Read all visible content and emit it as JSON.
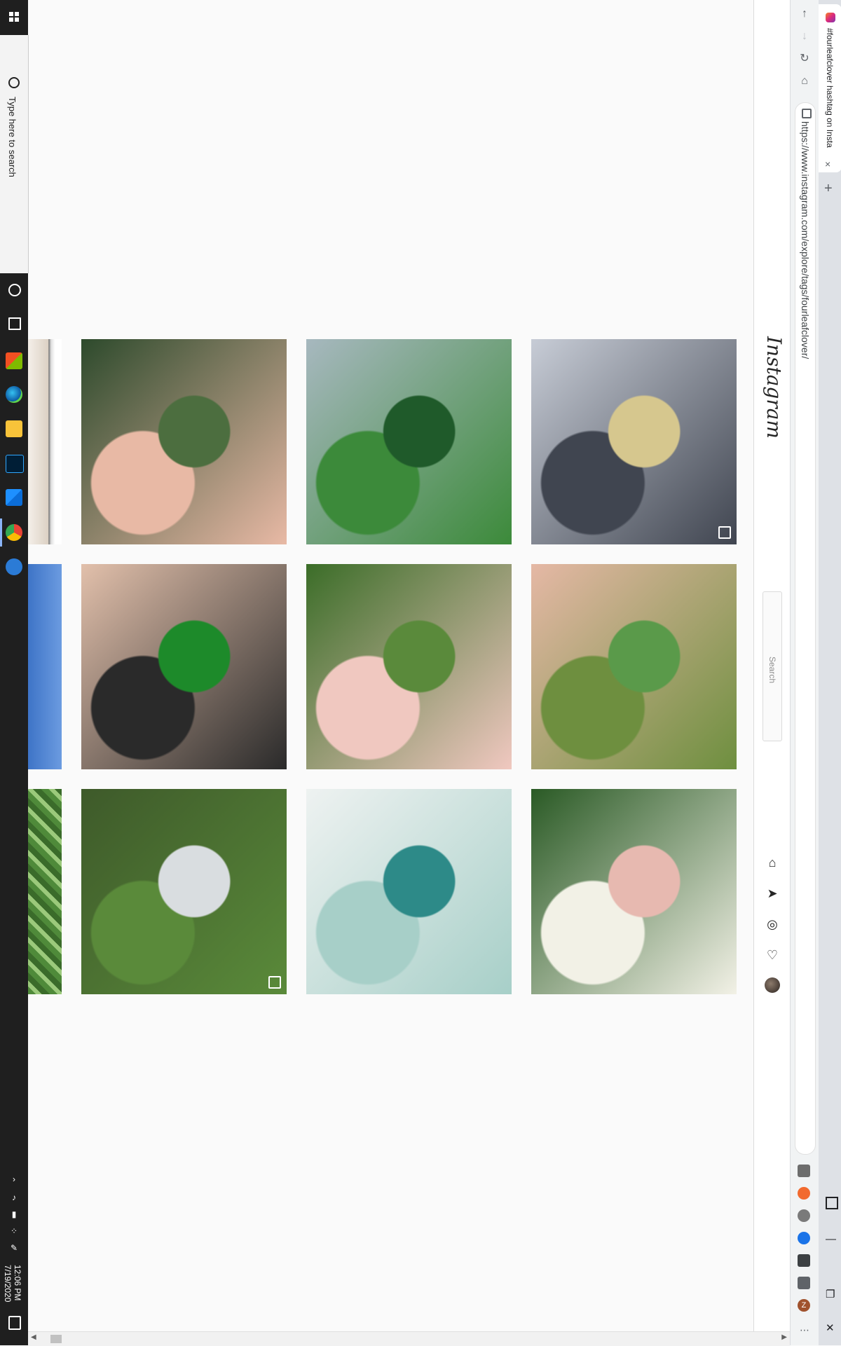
{
  "taskbar": {
    "search_placeholder": "Type here to search",
    "apps": [
      "cortana-icon",
      "task-view-icon",
      "microsoft-store-icon",
      "edge-icon",
      "file-explorer-icon",
      "photoshop-icon",
      "visual-studio-icon",
      "chrome-icon",
      "settings-icon"
    ],
    "clock_time": "12:06 PM",
    "clock_date": "7/19/2020"
  },
  "browser": {
    "tab_title": "#fourleafclover hashtag on Insta",
    "url": "https://www.instagram.com/explore/tags/fourleafclover/",
    "new_tab_symbol": "+",
    "close_symbol": "×",
    "extensions": [
      "grammarly-icon",
      "extension-orange-icon",
      "extension-gray-icon",
      "extension-blue-icon",
      "extension-green-icon",
      "puzzle-icon",
      "profile-z-icon"
    ],
    "profile_letter": "Z",
    "menu_symbol": "⋯",
    "window_controls": {
      "minimize": "—",
      "restore": "❐",
      "close": "✕"
    }
  },
  "instagram": {
    "logo": "Instagram",
    "search_placeholder": "Search",
    "nav_icons": [
      "home-icon",
      "direct-icon",
      "explore-icon",
      "activity-heart-icon",
      "profile-avatar"
    ]
  },
  "grid": {
    "rows": [
      [
        {
          "name": "post-hand-small-clover",
          "colors": [
            "#2d4a2c",
            "#4c6e3f",
            "#e8b9a5"
          ],
          "multi": false
        },
        {
          "name": "post-clover-on-granite",
          "colors": [
            "#a7b8bf",
            "#1f5a2a",
            "#3c8a3a"
          ],
          "multi": false
        },
        {
          "name": "post-clover-bracelet",
          "colors": [
            "#c7ccd6",
            "#d6c78e",
            "#404550"
          ],
          "multi": true
        }
      ],
      [
        {
          "name": "post-palm-big-clover",
          "colors": [
            "#e2c0ab",
            "#1d8a2a",
            "#2a2a2a"
          ],
          "multi": false
        },
        {
          "name": "post-fingers-clover-grass",
          "colors": [
            "#3b6d28",
            "#5a8a3b",
            "#f0c8c0"
          ],
          "multi": false
        },
        {
          "name": "post-clover-painted-nails",
          "colors": [
            "#e5b8a5",
            "#5a9a4a",
            "#6e8f3f"
          ],
          "multi": false
        }
      ],
      [
        {
          "name": "post-bushy-clover-sky",
          "colors": [
            "#3e5a2a",
            "#d9dde0",
            "#5a8a3a"
          ],
          "multi": true
        },
        {
          "name": "post-teal-cards-hand",
          "colors": [
            "#eef2f1",
            "#2d8a88",
            "#a7cfc8"
          ],
          "multi": false
        },
        {
          "name": "post-clover-field-hand",
          "colors": [
            "#2a5a25",
            "#e7b9b0",
            "#f2f1e6"
          ],
          "multi": false
        }
      ]
    ]
  }
}
